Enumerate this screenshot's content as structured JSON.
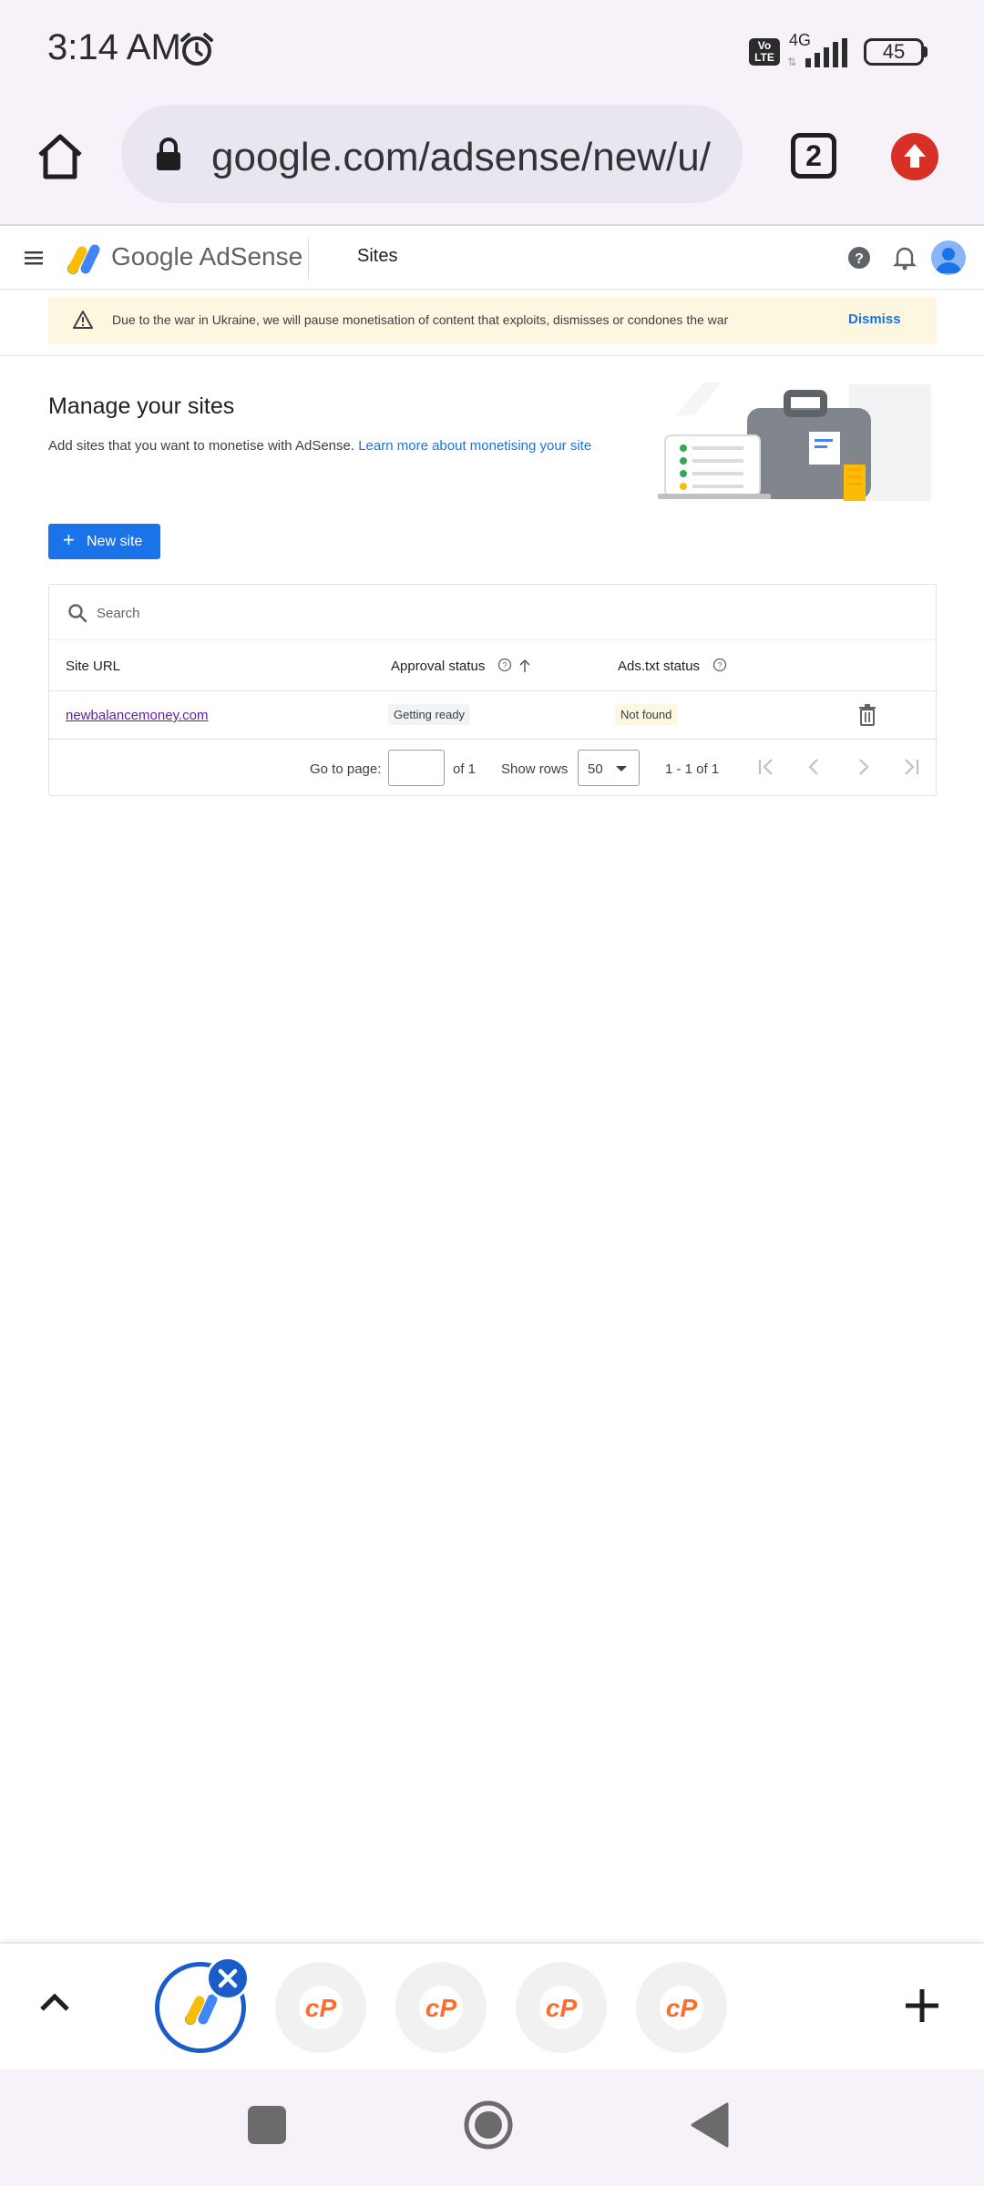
{
  "status_bar": {
    "time": "3:14 AM",
    "volte": "Vo LTE",
    "network": "4G",
    "battery": "45"
  },
  "browser": {
    "url": "google.com/adsense/new/u/",
    "tab_count": "2"
  },
  "header": {
    "brand": "Google AdSense",
    "section": "Sites"
  },
  "banner": {
    "text": "Due to the war in Ukraine, we will pause monetisation of content that exploits, dismisses or condones the war",
    "dismiss": "Dismiss"
  },
  "manage": {
    "title": "Manage your sites",
    "description": "Add sites that you want to monetise with AdSense.",
    "learn_more": "Learn more about monetising your site",
    "new_site": "New site"
  },
  "table": {
    "search_placeholder": "Search",
    "columns": {
      "site_url": "Site URL",
      "approval_status": "Approval status",
      "ads_txt_status": "Ads.txt status"
    },
    "rows": [
      {
        "site_url": "newbalancemoney.com",
        "approval_status": "Getting ready",
        "ads_txt_status": "Not found"
      }
    ],
    "pager": {
      "go_to_page": "Go to page:",
      "of_pages": "of 1",
      "show_rows": "Show rows",
      "rows_value": "50",
      "range": "1 - 1 of 1"
    }
  },
  "colors": {
    "accent": "#1a73e8",
    "banner_bg": "#fef7e0",
    "link_visited": "#681da8",
    "cpanel_orange": "#ff6c2c"
  }
}
